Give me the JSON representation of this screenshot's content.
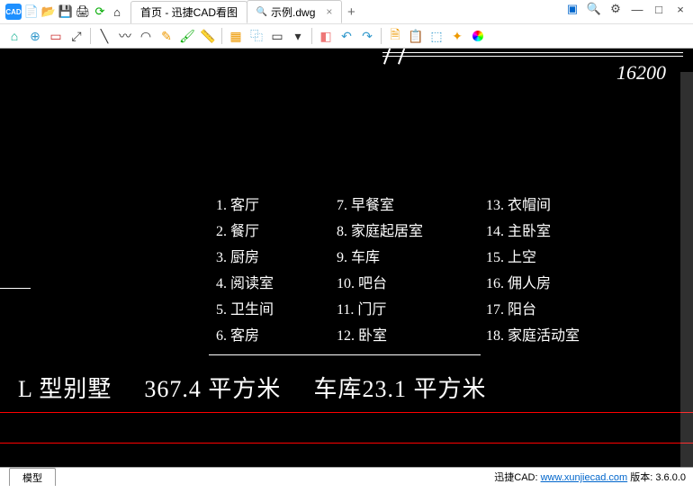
{
  "titlebar": {
    "app_badge": "CAD",
    "home_tab": "首页 - 迅捷CAD看图",
    "file_tab": "示例.dwg"
  },
  "toolbar": {
    "icons": [
      "home",
      "zoom",
      "select",
      "all",
      "|",
      "line",
      "poly",
      "arc",
      "rotate",
      "paint",
      "measure",
      "|",
      "layer",
      "copy",
      "rect",
      "dim",
      "|",
      "eraser",
      "undo",
      "redo",
      "|",
      "save",
      "print",
      "3d",
      "style",
      "material"
    ]
  },
  "canvas": {
    "dimension": "16200",
    "rooms_col1": [
      "1. 客厅",
      "2. 餐厅",
      "3. 厨房",
      "4. 阅读室",
      "5. 卫生间",
      "6. 客房"
    ],
    "rooms_col2": [
      "7. 早餐室",
      "8. 家庭起居室",
      "9. 车库",
      "10. 吧台",
      "11. 门厅",
      "12. 卧室"
    ],
    "rooms_col3": [
      "13. 衣帽间",
      "14. 主卧室",
      "15. 上空",
      "16. 佣人房",
      "17. 阳台",
      "18. 家庭活动室"
    ],
    "summary_title": "L 型别墅",
    "summary_area": "367.4 平方米",
    "summary_garage": "车库23.1 平方米"
  },
  "status": {
    "tab": "模型",
    "brand": "迅捷CAD: ",
    "url": "www.xunjiecad.com",
    "ver_label": " 版本: ",
    "ver": "3.6.0.0"
  }
}
